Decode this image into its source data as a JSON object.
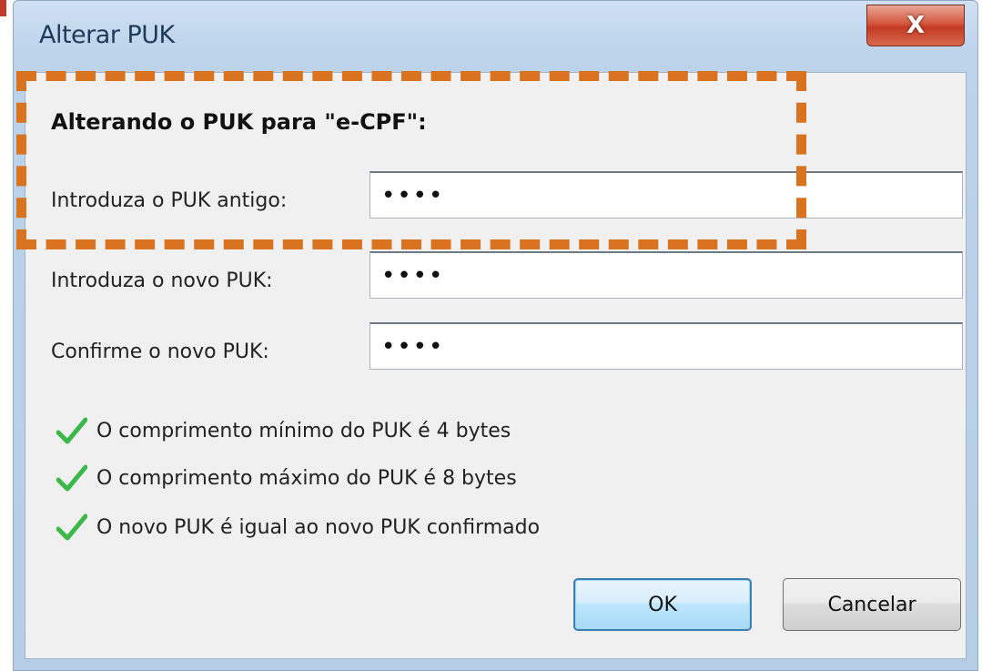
{
  "window": {
    "title": "Alterar PUK",
    "close_label": "X"
  },
  "dialog": {
    "heading": "Alterando o PUK para \"e-CPF\":",
    "fields": [
      {
        "label": "Introduza o PUK antigo:",
        "value": "••••"
      },
      {
        "label": "Introduza o novo PUK:",
        "value": "••••"
      },
      {
        "label": "Confirme o novo PUK:",
        "value": "••••"
      }
    ],
    "checks": [
      {
        "text": "O comprimento mínimo do PUK é 4 bytes",
        "icon": "checkmark-icon"
      },
      {
        "text": "O comprimento máximo do PUK é 8 bytes",
        "icon": "checkmark-icon"
      },
      {
        "text": "O novo PUK é igual ao novo PUK confirmado",
        "icon": "checkmark-icon"
      }
    ],
    "buttons": {
      "ok": "OK",
      "cancel": "Cancelar"
    }
  },
  "colors": {
    "highlight": "#d9731f",
    "check": "#3cb84a",
    "close": "#c23b22"
  }
}
